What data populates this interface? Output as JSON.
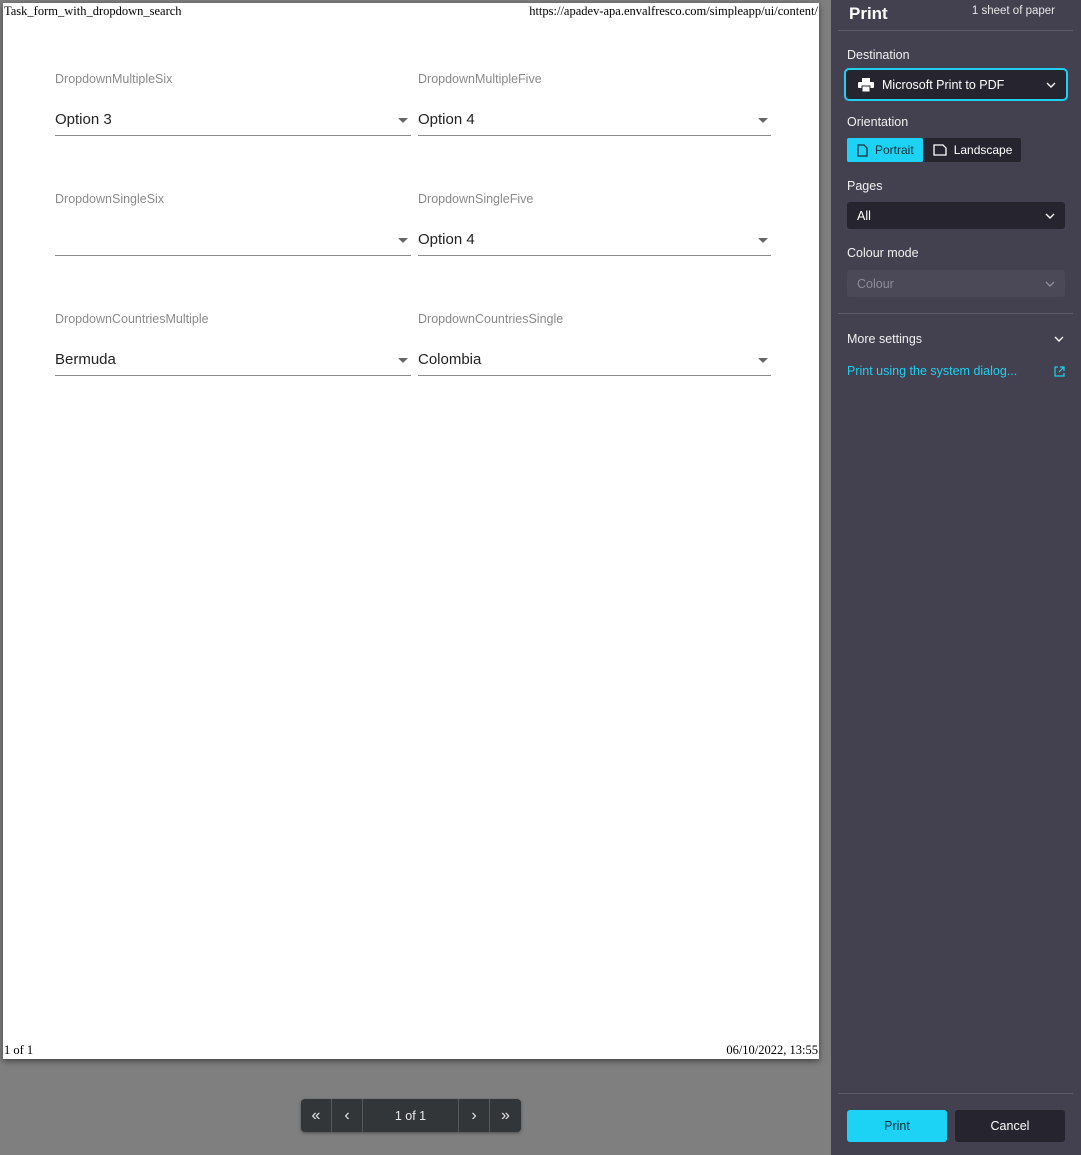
{
  "preview": {
    "header_title": "Task_form_with_dropdown_search",
    "header_url": "https://apadev-apa.envalfresco.com/simpleapp/ui/content/",
    "footer_page": "1 of 1",
    "footer_date": "06/10/2022, 13:55",
    "fields": [
      {
        "label": "DropdownMultipleSix",
        "value": "Option 3"
      },
      {
        "label": "DropdownMultipleFive",
        "value": "Option 4"
      },
      {
        "label": "DropdownSingleSix",
        "value": ""
      },
      {
        "label": "DropdownSingleFive",
        "value": "Option 4"
      },
      {
        "label": "DropdownCountriesMultiple",
        "value": "Bermuda"
      },
      {
        "label": "DropdownCountriesSingle",
        "value": "Colombia"
      }
    ]
  },
  "pager": {
    "first_icon": "«",
    "prev_icon": "‹",
    "info": "1 of 1",
    "next_icon": "›",
    "last_icon": "»"
  },
  "sidebar": {
    "title": "Print",
    "sheets": "1 sheet of paper",
    "destination_label": "Destination",
    "destination_value": "Microsoft Print to PDF",
    "orientation_label": "Orientation",
    "orientation_portrait": "Portrait",
    "orientation_landscape": "Landscape",
    "pages_label": "Pages",
    "pages_value": "All",
    "colour_label": "Colour mode",
    "colour_value": "Colour",
    "more_settings": "More settings",
    "system_dialog": "Print using the system dialog...",
    "print_button": "Print",
    "cancel_button": "Cancel"
  },
  "colors": {
    "accent": "#1cd3f6",
    "sidebar_bg": "#434150",
    "control_bg": "#26242f",
    "preview_bg": "#7f7f7f"
  }
}
